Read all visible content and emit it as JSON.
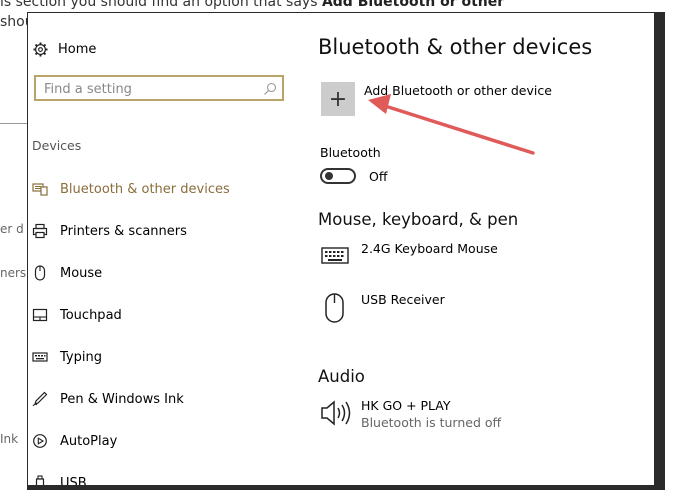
{
  "background_article": {
    "line1_prefix": "is section you should find an option that says",
    "line1_bold": "Add Bluetooth or other",
    "line2": "shou",
    "side_fragments": [
      "er d",
      "ners",
      "Ink"
    ]
  },
  "sidebar": {
    "home_label": "Home",
    "search_placeholder": "Find a setting",
    "section_heading": "Devices",
    "items": [
      {
        "label": "Bluetooth & other devices",
        "icon": "bluetooth-devices-icon",
        "active": true
      },
      {
        "label": "Printers & scanners",
        "icon": "printer-icon"
      },
      {
        "label": "Mouse",
        "icon": "mouse-icon"
      },
      {
        "label": "Touchpad",
        "icon": "touchpad-icon"
      },
      {
        "label": "Typing",
        "icon": "keyboard-icon"
      },
      {
        "label": "Pen & Windows Ink",
        "icon": "pen-icon"
      },
      {
        "label": "AutoPlay",
        "icon": "autoplay-icon"
      },
      {
        "label": "USB",
        "icon": "usb-icon"
      }
    ]
  },
  "main": {
    "title": "Bluetooth & other devices",
    "add_button_glyph": "+",
    "add_label": "Add Bluetooth or other device",
    "bluetooth_label": "Bluetooth",
    "bluetooth_state": "Off",
    "bluetooth_on": false,
    "mouse_section_title": "Mouse, keyboard, & pen",
    "mouse_devices": [
      {
        "name": "2.4G Keyboard Mouse",
        "icon": "keyboard-icon"
      },
      {
        "name": "USB Receiver",
        "icon": "mouse-icon"
      }
    ],
    "audio_section_title": "Audio",
    "audio_devices": [
      {
        "name": "HK GO + PLAY",
        "status": "Bluetooth is turned off",
        "icon": "speaker-icon"
      }
    ]
  },
  "colors": {
    "accent": "#8a6d3b",
    "search_border": "#b9a36b",
    "frame": "#2b2b2b",
    "annotation_arrow": "#e05a5a",
    "add_button_bg": "#cccccc"
  }
}
